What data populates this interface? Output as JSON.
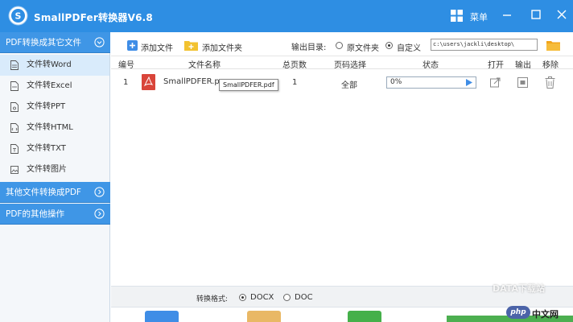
{
  "window": {
    "title": "SmallPDFer转换器V6.8",
    "menu_label": "菜单"
  },
  "sidebar": {
    "group1": "PDF转换成其它文件",
    "items": [
      {
        "label": "文件转Word",
        "active": true
      },
      {
        "label": "文件转Excel",
        "active": false
      },
      {
        "label": "文件转PPT",
        "active": false
      },
      {
        "label": "文件转HTML",
        "active": false
      },
      {
        "label": "文件转TXT",
        "active": false
      },
      {
        "label": "文件转图片",
        "active": false
      }
    ],
    "group2": "其他文件转换成PDF",
    "group3": "PDF的其他操作"
  },
  "toolbar": {
    "add_file": "添加文件",
    "add_folder": "添加文件夹",
    "output_dir_label": "输出目录:",
    "option_source_folder": "原文件夹",
    "option_custom": "自定义",
    "output_path": "c:\\users\\jackli\\desktop\\"
  },
  "table": {
    "headers": {
      "index": "编号",
      "filename": "文件名称",
      "pages": "总页数",
      "page_select": "页码选择",
      "status": "状态",
      "open": "打开",
      "output": "输出",
      "remove": "移除"
    },
    "rows": [
      {
        "index": "1",
        "filename": "SmallPDFER.pdf",
        "filename_truncated": "SmallPDFER.pc",
        "tooltip": "SmallPDFER.pdf",
        "pages": "1",
        "page_select": "全部",
        "progress_text": "0%",
        "progress": 0
      }
    ]
  },
  "bottom": {
    "format_label": "转换格式:",
    "format_docx": "DOCX",
    "format_doc": "DOC"
  },
  "watermark": {
    "text": "DATA下载站",
    "php_badge": "php",
    "php_text": "中文网"
  },
  "colors": {
    "brand_blue": "#2e8ee3",
    "sidebar_group": "#3f96e6",
    "active_item": "#d9ebfb",
    "pdf_red": "#d9453a",
    "folder_yellow": "#f2c230"
  }
}
